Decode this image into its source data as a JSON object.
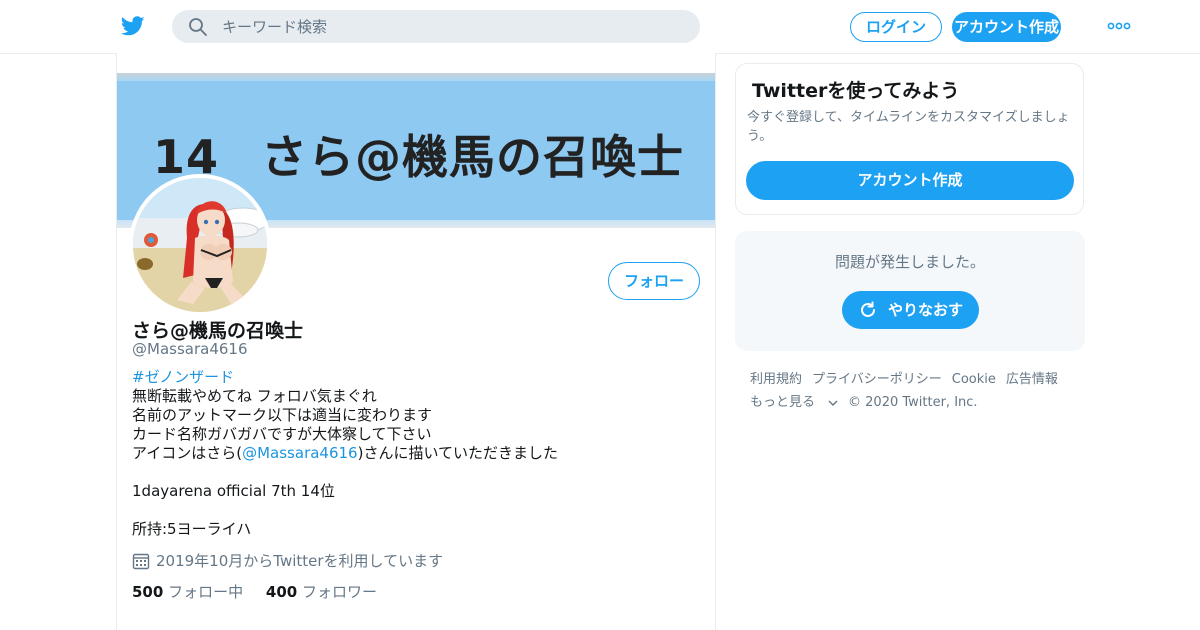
{
  "header": {
    "search_placeholder": "キーワード検索",
    "login_label": "ログイン",
    "signup_label": "アカウント作成"
  },
  "profile": {
    "banner_number": "14",
    "banner_text": "さら@機馬の召喚士",
    "follow_label": "フォロー",
    "display_name": "さら@機馬の召喚士",
    "handle": "@Massara4616",
    "bio": {
      "hashtag": "#ゼノンザード",
      "line1": "無断転載やめてね フォロバ気まぐれ",
      "line2": "名前のアットマーク以下は適当に変わります",
      "line3": "カード名称ガバガバですが大体察して下さい",
      "line4_prefix": "アイコンはさら(",
      "line4_mention": "@Massara4616",
      "line4_suffix": ")さんに描いていただきました",
      "line5": "1dayarena official 7th 14位",
      "line6": "所持:5ヨーライハ"
    },
    "joined": "2019年10月からTwitterを利用しています",
    "following_count": "500",
    "following_label": "フォロー中",
    "followers_count": "400",
    "followers_label": "フォロワー"
  },
  "sidebar": {
    "signup_card": {
      "title": "Twitterを使ってみよう",
      "description": "今すぐ登録して、タイムラインをカスタマイズしましょう。",
      "button_label": "アカウント作成"
    },
    "error_card": {
      "message": "問題が発生しました。",
      "retry_label": "やりなおす"
    },
    "footer": {
      "terms": "利用規約",
      "privacy": "プライバシーポリシー",
      "cookie": "Cookie",
      "ads": "広告情報",
      "more": "もっと見る",
      "copyright": "© 2020 Twitter, Inc."
    }
  },
  "colors": {
    "accent": "#1da1f2",
    "link": "#1b95e0",
    "muted_text": "#657786",
    "banner_bg": "#8ec9f2"
  },
  "icons": [
    "twitter-logo-icon",
    "search-icon",
    "more-dots-icon",
    "calendar-icon",
    "refresh-icon",
    "chevron-down-icon"
  ]
}
